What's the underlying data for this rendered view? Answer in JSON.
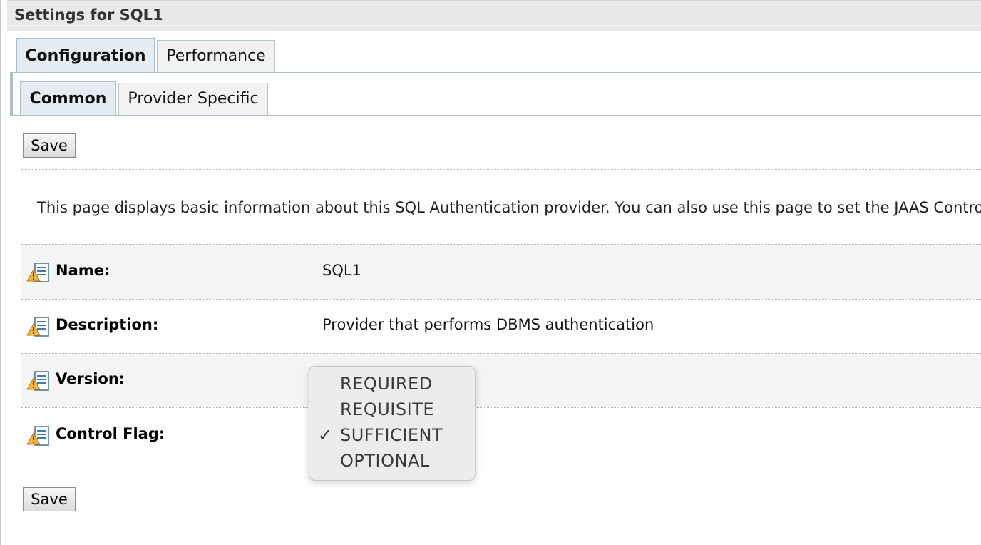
{
  "page": {
    "title": "Settings for SQL1"
  },
  "tabs": {
    "primary": [
      {
        "label": "Configuration",
        "active": true
      },
      {
        "label": "Performance",
        "active": false
      }
    ],
    "secondary": [
      {
        "label": "Common",
        "active": true
      },
      {
        "label": "Provider Specific",
        "active": false
      }
    ]
  },
  "buttons": {
    "save_top": "Save",
    "save_bottom": "Save"
  },
  "intro_text": "This page displays basic information about this SQL Authentication provider. You can also use this page to set the JAAS Control Flag to control how this provider is used in the login sequence.",
  "fields": [
    {
      "label": "Name:",
      "value": "SQL1",
      "icon": "help-config-icon"
    },
    {
      "label": "Description:",
      "value": "Provider that performs DBMS authentication",
      "icon": "help-config-icon"
    },
    {
      "label": "Version:",
      "value": "",
      "icon": "help-config-icon"
    },
    {
      "label": "Control Flag:",
      "value": "SUFFICIENT",
      "icon": "help-config-icon"
    }
  ],
  "control_flag_dropdown": {
    "options": [
      "REQUIRED",
      "REQUISITE",
      "SUFFICIENT",
      "OPTIONAL"
    ],
    "selected": "SUFFICIENT",
    "check_glyph": "✓"
  },
  "colors": {
    "tab_active_bg": "#e5edf3",
    "tab_border": "#a9bfcf",
    "title_bar_bg": "#e9e9e9",
    "row_shade": "#f4f4f4"
  }
}
